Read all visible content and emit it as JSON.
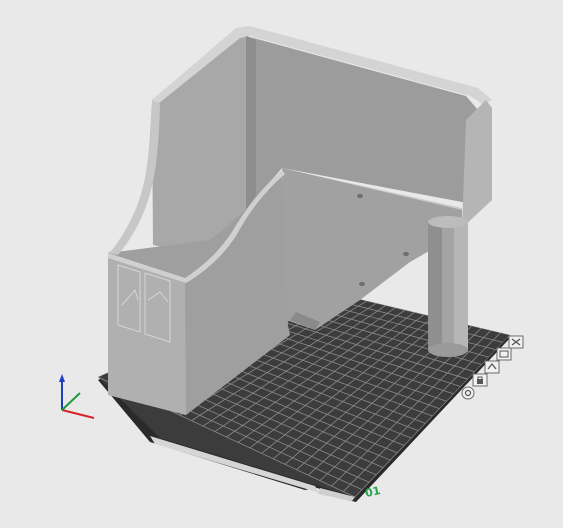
{
  "viewport": {
    "plate_label": "01"
  },
  "colors": {
    "background": "#e9e9e9",
    "plate": "#3c3c3c",
    "plate_grid": "#8a8a8a",
    "model_light": "#b9b9b9",
    "model_mid": "#a3a3a3",
    "model_dark": "#8d8d8d",
    "axis_x": "#d8232a",
    "axis_y": "#1a9b3c",
    "axis_z": "#1f3fbf",
    "label_green": "#23a34a"
  },
  "plate_toolbar": {
    "icons": [
      {
        "name": "close-plate-icon"
      },
      {
        "name": "arrange-plate-icon"
      },
      {
        "name": "orient-plate-icon"
      },
      {
        "name": "lock-plate-icon"
      },
      {
        "name": "plate-settings-icon"
      },
      {
        "name": "plate-type-icon"
      }
    ]
  }
}
